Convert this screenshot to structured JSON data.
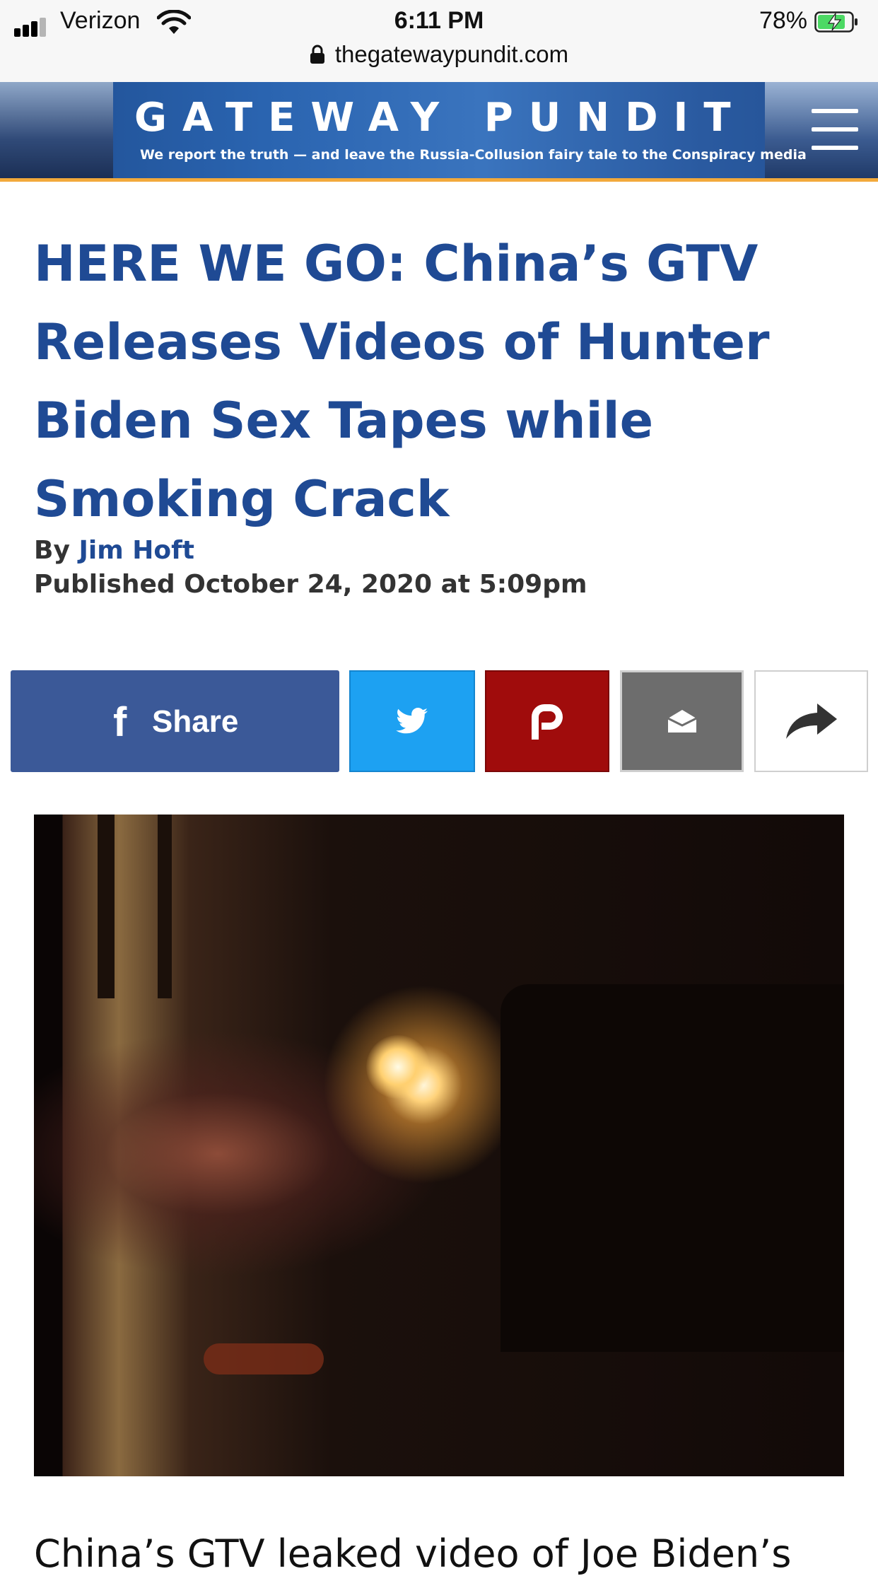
{
  "status_bar": {
    "carrier": "Verizon",
    "time": "6:11 PM",
    "battery_percent": "78%",
    "url": "thegatewaypundit.com"
  },
  "header": {
    "brand": "GATEWAY PUNDIT",
    "tagline": "We report the truth — and leave the Russia-Collusion fairy tale to the Conspiracy media",
    "menu_icon": "hamburger-icon"
  },
  "article": {
    "title": "HERE WE GO: China’s GTV Releases Videos of Hunter Biden Sex Tapes while Smoking Crack",
    "byline_prefix": "By",
    "author": "Jim Hoft",
    "published": "Published October 24, 2020 at 5:09pm",
    "body_start": "China’s GTV leaked video of Joe Biden’s"
  },
  "share": {
    "facebook_label": "Share",
    "icons": [
      "facebook-icon",
      "twitter-icon",
      "parler-icon",
      "email-icon",
      "share-arrow-icon"
    ]
  },
  "colors": {
    "title": "#1f4a94",
    "facebook": "#3b5998",
    "twitter": "#1da1f2",
    "parler": "#a00c0c",
    "email": "#6d6d6d",
    "banner_accent": "#f2a93b"
  }
}
